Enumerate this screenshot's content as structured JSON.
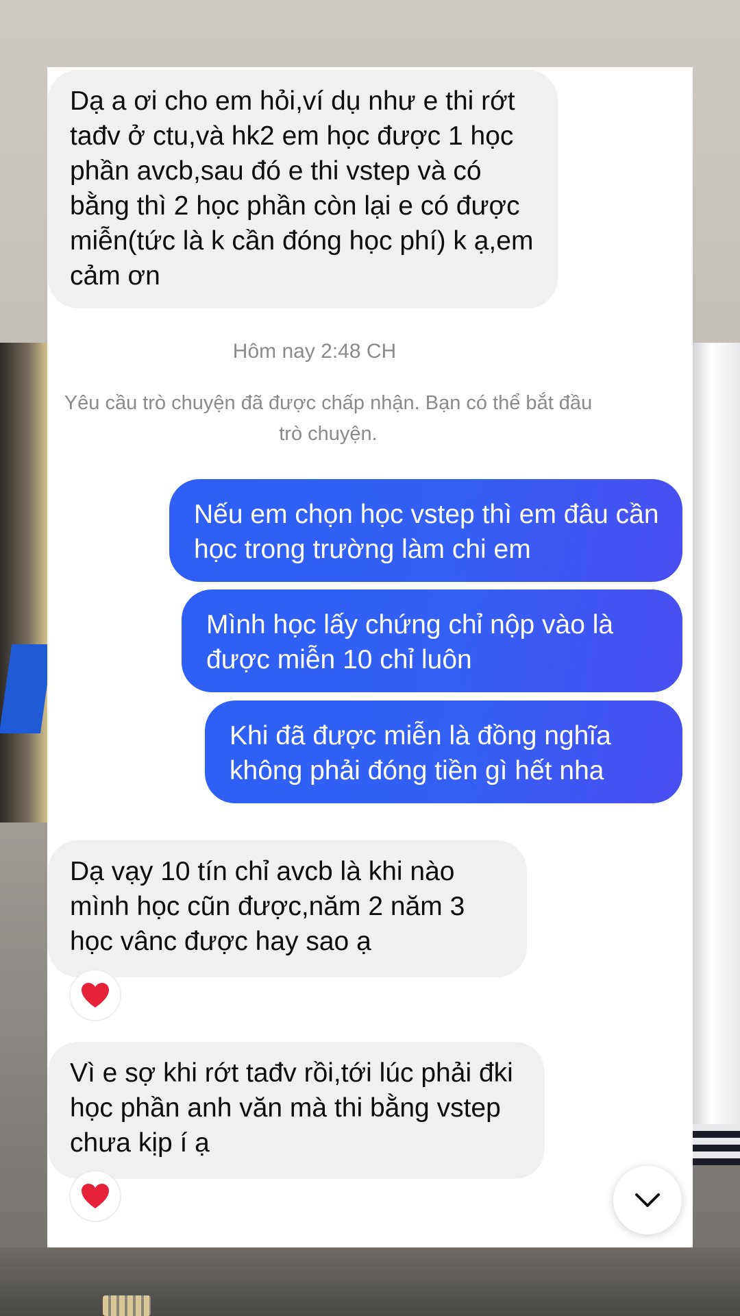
{
  "colors": {
    "sent_bubble": "#3461f3",
    "received_bubble": "#f0f0f1",
    "meta_text": "#8a8a8e",
    "reaction_heart": "#e6223a"
  },
  "messages": [
    {
      "direction": "received",
      "text": "Dạ a ơi cho em hỏi,ví dụ như e thi rớt tađv ở ctu,và hk2 em học được 1 học phần avcb,sau đó e thi vstep và có bằng thì 2 học phần còn lại e có được miễn(tức là k cần đóng học phí) k ạ,em cảm ơn"
    },
    {
      "direction": "sent",
      "text": "Nếu em chọn học vstep thì em đâu cần học trong trường làm chi em"
    },
    {
      "direction": "sent",
      "text": "Mình học lấy chứng chỉ nộp vào là được miễn 10 chỉ luôn"
    },
    {
      "direction": "sent",
      "text": "Khi đã được miễn là đồng nghĩa không phải đóng tiền gì hết nha"
    },
    {
      "direction": "received",
      "text": "Dạ vạy 10 tín chỉ avcb là khi nào mình học cũn được,năm 2 năm 3 học vânc được hay sao ạ",
      "reaction": "heart-icon"
    },
    {
      "direction": "received",
      "text": "Vì e sợ khi rớt tađv rồi,tới lúc phải đki học phần anh văn mà thi bằng vstep chưa kịp í ạ",
      "reaction": "heart-icon"
    }
  ],
  "timestamp": "Hôm nay 2:48 CH",
  "system_notice": "Yêu cầu trò chuyện đã được chấp nhận. Bạn có thể bắt đầu trò chuyện.",
  "scroll_down_icon": "chevron-down-icon"
}
